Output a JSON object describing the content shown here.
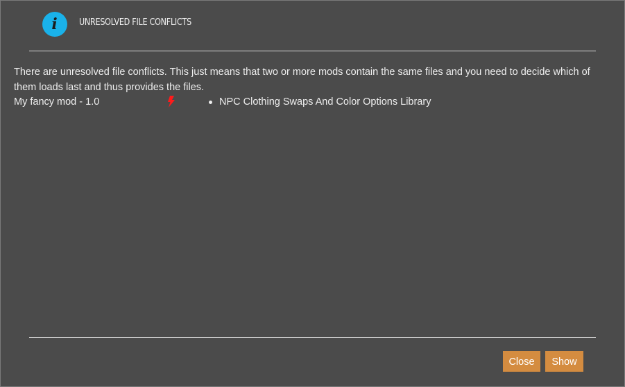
{
  "dialog": {
    "title": "UNRESOLVED FILE CONFLICTS",
    "icon": "info-icon",
    "message": "There are unresolved file conflicts. This just means that two or more mods contain the same files and you need to decide which of them loads last and thus provides the files."
  },
  "conflicts": [
    {
      "mod": "My fancy mod - 1.0",
      "icon": "lightning-bolt-icon",
      "icon_color": "#ff1a1a",
      "conflicts_with": [
        "NPC Clothing Swaps And Color Options Library"
      ]
    }
  ],
  "buttons": {
    "close_label": "Close",
    "show_label": "Show"
  },
  "colors": {
    "background": "#4b4b4b",
    "accent_button": "#d48c40",
    "info_icon": "#1ab2ea",
    "conflict_icon": "#ff1a1a"
  }
}
